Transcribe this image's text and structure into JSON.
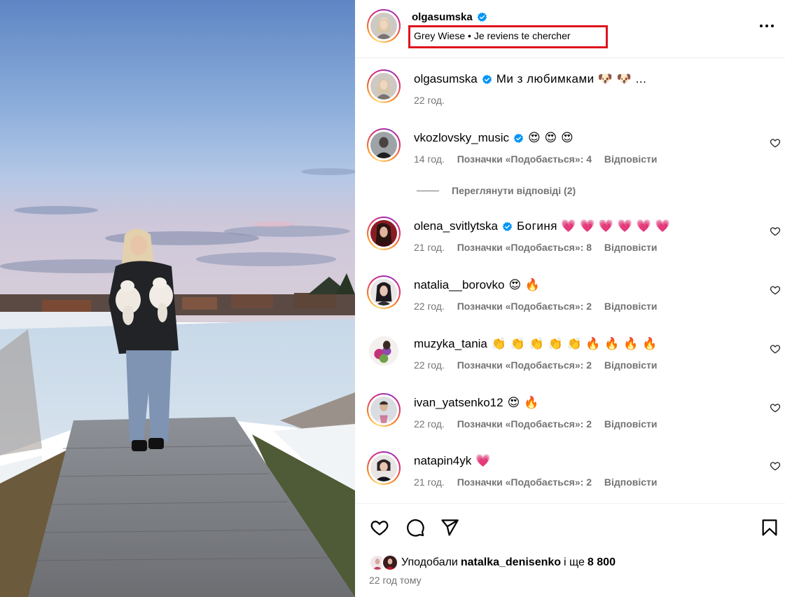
{
  "header": {
    "username": "olgasumska",
    "audio_artist": "Grey Wiese",
    "audio_separator": "•",
    "audio_title": "Je reviens te chercher",
    "more_icon": "more-horizontal-icon"
  },
  "caption": {
    "username": "olgasumska",
    "text": "Ми з любимками 🐶 🐶 ...",
    "time": "22 год."
  },
  "comments": [
    {
      "username": "vkozlovsky_music",
      "verified": true,
      "text": "😍 😍 😍",
      "time": "14 год.",
      "likes": "Позначки «Подобається»: 4",
      "reply": "Відповісти"
    },
    {
      "username": "olena_svitlytska",
      "verified": true,
      "text": "Богиня 💗 💗 💗 💗 💗 💗",
      "time": "21 год.",
      "likes": "Позначки «Подобається»: 8",
      "reply": "Відповісти"
    },
    {
      "username": "natalia__borovko",
      "verified": false,
      "text": "😍 🔥",
      "time": "22 год.",
      "likes": "Позначки «Подобається»: 2",
      "reply": "Відповісти"
    },
    {
      "username": "muzyka_tania",
      "verified": false,
      "text": "👏 👏 👏 👏 👏 🔥 🔥 🔥 🔥",
      "time": "22 год.",
      "likes": "Позначки «Подобається»: 2",
      "reply": "Відповісти"
    },
    {
      "username": "ivan_yatsenko12",
      "verified": false,
      "text": "😍 🔥",
      "time": "22 год.",
      "likes": "Позначки «Подобається»: 2",
      "reply": "Відповісти"
    },
    {
      "username": "natapin4yk",
      "verified": false,
      "text": "💗",
      "time": "21 год.",
      "likes": "Позначки «Подобається»: 2",
      "reply": "Відповісти"
    }
  ],
  "view_replies": "Переглянути відповіді (2)",
  "footer": {
    "liked_prefix": "Уподобали",
    "liked_user": "natalka_denisenko",
    "liked_and": "і ще",
    "liked_count": "8 800",
    "time_ago": "22 год тому"
  },
  "colors": {
    "highlight_box": "#e0141e",
    "verified": "#0095f6",
    "muted": "#737373"
  }
}
